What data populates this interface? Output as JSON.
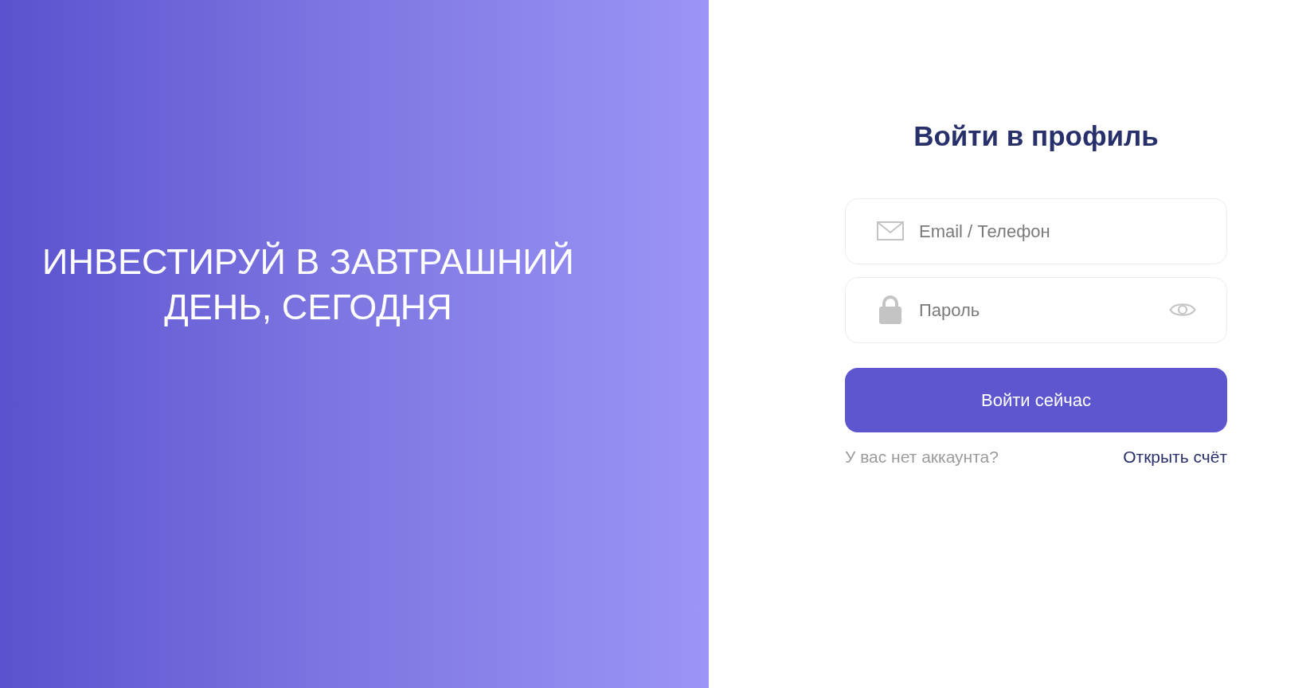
{
  "promo": {
    "tagline": "ИНВЕСТИРУЙ В ЗАВТРАШНИЙ ДЕНЬ, СЕГОДНЯ"
  },
  "login_form": {
    "title": "Войти в профиль",
    "fields": [
      {
        "kind": "email",
        "placeholder": "Email / Телефон"
      },
      {
        "kind": "password",
        "placeholder": "Пароль"
      }
    ],
    "submit_button": "Войти сейчас",
    "signup_prompt": "У вас нет аккаунта?",
    "signup_link": "Открыть счёт"
  }
}
